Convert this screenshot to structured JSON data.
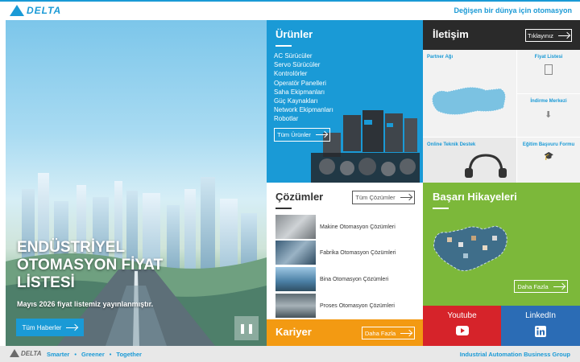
{
  "header": {
    "logo_text": "DELTA",
    "slogan": "Değişen bir dünya için otomasyon"
  },
  "hero": {
    "title": "ENDÜSTRİYEL OTOMASYON FİYAT LİSTESİ",
    "subtitle": "Mayıs 2026 fiyat listemiz yayınlanmıştır.",
    "button_label": "Tüm Haberler",
    "control_icon": "pause-icon"
  },
  "products": {
    "title": "Ürünler",
    "items": [
      "AC Sürücüler",
      "Servo Sürücüler",
      "Kontrolörler",
      "Operatör Panelleri",
      "Saha Ekipmanları",
      "Güç Kaynakları",
      "Network Ekipmanları",
      "Robotlar"
    ],
    "button_label": "Tüm Ürünler"
  },
  "contact": {
    "title": "İletişim",
    "button_label": "Tıklayınız",
    "cells": {
      "partner": "Partner Ağı",
      "price_list": "Fiyat Listesi",
      "download": "İndirme Merkezi",
      "support": "Online Teknik Destek",
      "training": "Eğitim Başvuru Formu"
    }
  },
  "solutions": {
    "title": "Çözümler",
    "button_label": "Tüm Çözümler",
    "items": [
      "Makine Otomasyon Çözümleri",
      "Fabrika Otomasyon Çözümleri",
      "Bina Otomasyon Çözümleri",
      "Proses Otomasyon Çözümleri"
    ]
  },
  "career": {
    "title": "Kariyer",
    "button_label": "Daha Fazla"
  },
  "success": {
    "title": "Başarı Hikayeleri",
    "button_label": "Daha Fazla"
  },
  "social": {
    "youtube": "Youtube",
    "linkedin": "LinkedIn"
  },
  "footer": {
    "logo_text": "DELTA",
    "taglines": [
      "Smarter",
      "Greener",
      "Together"
    ],
    "group": "Industrial Automation Business Group"
  },
  "colors": {
    "brand_blue": "#1a9ad6",
    "dark": "#2a2a2a",
    "green": "#7cb83a",
    "orange": "#f39a12",
    "youtube_red": "#d6232a",
    "linkedin_blue": "#2b6cb5"
  }
}
